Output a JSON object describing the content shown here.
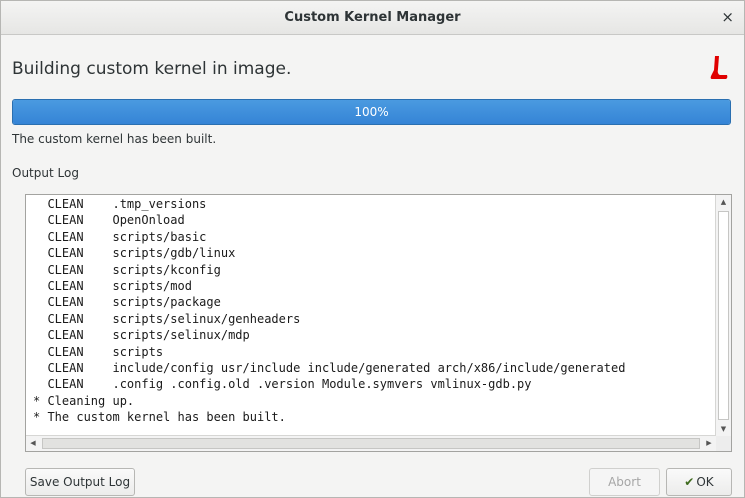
{
  "window": {
    "title": "Custom Kernel Manager",
    "close_glyph": "×"
  },
  "header": {
    "heading": "Building custom kernel in image.",
    "logo_icon": "redhat-logo-icon",
    "logo_color": "#e00000"
  },
  "progress": {
    "value": 1.0,
    "label": "100%",
    "color": "#3584d6"
  },
  "status": {
    "text": "The custom kernel has been built."
  },
  "log": {
    "label": "Output Log",
    "lines": [
      "  CLEAN    .tmp_versions",
      "  CLEAN    OpenOnload",
      "  CLEAN    scripts/basic",
      "  CLEAN    scripts/gdb/linux",
      "  CLEAN    scripts/kconfig",
      "  CLEAN    scripts/mod",
      "  CLEAN    scripts/package",
      "  CLEAN    scripts/selinux/genheaders",
      "  CLEAN    scripts/selinux/mdp",
      "  CLEAN    scripts",
      "  CLEAN    include/config usr/include include/generated arch/x86/include/generated",
      "  CLEAN    .config .config.old .version Module.symvers vmlinux-gdb.py",
      "* Cleaning up.",
      "* The custom kernel has been built."
    ]
  },
  "buttons": {
    "save_log": "Save Output Log",
    "abort": "Abort",
    "ok": "OK",
    "ok_icon": "checkmark-icon"
  }
}
